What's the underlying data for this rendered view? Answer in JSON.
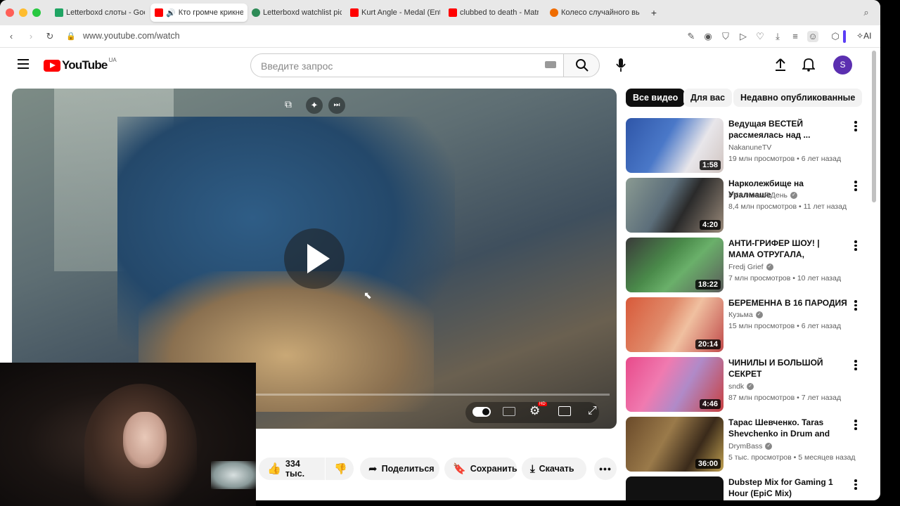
{
  "browser": {
    "tabs": [
      {
        "title": "Letterboxd слоты - Goog",
        "fav_color": "#1fa463",
        "active": false
      },
      {
        "title": "Кто громче крикнет",
        "fav_color": "#ff0000",
        "active": true
      },
      {
        "title": "Letterboxd watchlist pic",
        "fav_color": "#2e8b57",
        "active": false
      },
      {
        "title": "Kurt Angle - Medal (Ente",
        "fav_color": "#ff0000",
        "active": false
      },
      {
        "title": "clubbed to death - Matri",
        "fav_color": "#ff0000",
        "active": false
      },
      {
        "title": "Колесо случайного вы",
        "fav_color": "#ef6c00",
        "active": false
      }
    ],
    "url": "www.youtube.com/watch",
    "ai_label": "AI"
  },
  "youtube": {
    "logo": "YouTube",
    "region": "UA",
    "search_placeholder": "Введите запрос",
    "avatar_letter": "S",
    "filters": [
      "Все видео",
      "Для вас",
      "Недавно опубликованные"
    ],
    "actions": {
      "likes": "334 тыс.",
      "share": "Поделиться",
      "save": "Сохранить",
      "download": "Скачать"
    },
    "recommendations": [
      {
        "title": "Ведущая ВЕСТЕЙ рассмеялась над ...",
        "channel": "NakanuneTV",
        "verified": false,
        "views": "19 млн просмотров",
        "age": "6 лет назад",
        "duration": "1:58",
        "thumb": "#3a5fa8"
      },
      {
        "title": "Нарколежбище на Уралмаше",
        "channel": "РИА Новый День",
        "verified": true,
        "views": "8,4 млн просмотров",
        "age": "11 лет назад",
        "duration": "4:20",
        "thumb": "#6f7e7a"
      },
      {
        "title": "АНТИ-ГРИФЕР ШОУ! | МАМА ОТРУГАЛА, НЕПОСЛУШНОГ...",
        "channel": "Fredj Grief",
        "verified": true,
        "views": "7 млн просмотров",
        "age": "10 лет назад",
        "duration": "18:22",
        "thumb": "#4a7a4a"
      },
      {
        "title": "БЕРЕМЕННА В 16 ПАРОДИЯ",
        "channel": "Кузьма",
        "verified": true,
        "views": "15 млн просмотров",
        "age": "6 лет назад",
        "duration": "20:14",
        "thumb": "#c96a4a"
      },
      {
        "title": "ЧИНИЛЫ И БОЛЬШОЙ СЕКРЕТ",
        "channel": "sndk",
        "verified": true,
        "views": "87 млн просмотров",
        "age": "7 лет назад",
        "duration": "4:46",
        "thumb": "#d94f8a"
      },
      {
        "title": "Тарас Шевченко. Taras Shevchenko in Drum and Bass...",
        "channel": "DrymBass",
        "verified": true,
        "views": "5 тыс. просмотров",
        "age": "5 месяцев назад",
        "duration": "36:00",
        "thumb": "#7a5a3a"
      },
      {
        "title": "Dubstep Mix for Gaming 1 Hour (EpiC Mix)",
        "channel": "",
        "verified": false,
        "views": "",
        "age": "",
        "duration": "",
        "thumb": "#111111"
      }
    ]
  }
}
